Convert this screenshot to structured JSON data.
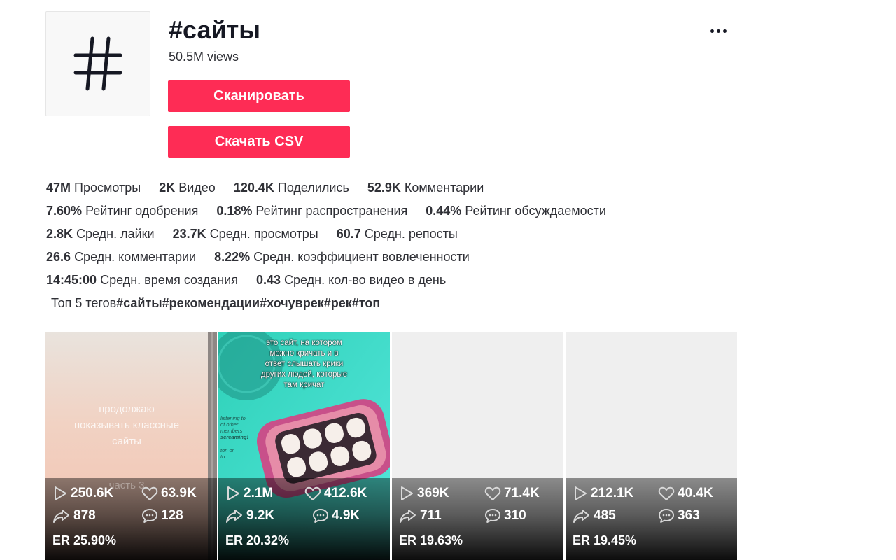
{
  "header": {
    "title": "#сайты",
    "views": "50.5M views",
    "scan_label": "Сканировать",
    "csv_label": "Скачать CSV",
    "more_icon": "more-dots-icon"
  },
  "stats": {
    "row1": [
      {
        "value": "47M",
        "label": "Просмотры"
      },
      {
        "value": "2K",
        "label": "Видео"
      },
      {
        "value": "120.4K",
        "label": "Поделились"
      },
      {
        "value": "52.9K",
        "label": "Комментарии"
      }
    ],
    "row2": [
      {
        "value": "7.60%",
        "label": "Рейтинг одобрения"
      },
      {
        "value": "0.18%",
        "label": "Рейтинг распространения"
      },
      {
        "value": "0.44%",
        "label": "Рейтинг обсуждаемости"
      }
    ],
    "row3": [
      {
        "value": "2.8K",
        "label": "Средн. лайки"
      },
      {
        "value": "23.7K",
        "label": "Средн. просмотры"
      },
      {
        "value": "60.7",
        "label": "Средн. репосты"
      }
    ],
    "row4": [
      {
        "value": "26.6",
        "label": "Средн. комментарии"
      },
      {
        "value": "8.22%",
        "label": "Средн. коэффициент вовлеченности"
      }
    ],
    "row5": [
      {
        "value": "14:45:00",
        "label": "Средн. время создания"
      },
      {
        "value": "0.43",
        "label": "Средн. кол-во видео в день"
      }
    ]
  },
  "top_tags": {
    "label": "Топ 5 тегов",
    "tags": [
      "#сайты",
      "#рекомендации",
      "#хочуврек",
      "#рек",
      "#топ"
    ]
  },
  "videos": [
    {
      "plays": "250.6K",
      "likes": "63.9K",
      "shares": "878",
      "comments": "128",
      "er": "ER 25.90%",
      "caption": [
        "продолжаю",
        "показывать классные",
        "сайты"
      ],
      "caption_part": "часть 3"
    },
    {
      "plays": "2.1M",
      "likes": "412.6K",
      "shares": "9.2K",
      "comments": "4.9K",
      "er": "ER 20.32%",
      "caption": [
        "это сайт, на котором",
        "можно кричать и в",
        "ответ слышать крики",
        "других людей, которые",
        "там кричат"
      ],
      "side_text": [
        "listening to",
        "of other",
        "members",
        "screaming!",
        "ton or",
        "to"
      ]
    },
    {
      "plays": "369K",
      "likes": "71.4K",
      "shares": "711",
      "comments": "310",
      "er": "ER 19.63%"
    },
    {
      "plays": "212.1K",
      "likes": "40.4K",
      "shares": "485",
      "comments": "363",
      "er": "ER 19.45%"
    }
  ],
  "colors": {
    "accent": "#fe2c55",
    "text": "#161823",
    "thumb_empty": "#efefef",
    "teal": "#3fd9c8"
  }
}
